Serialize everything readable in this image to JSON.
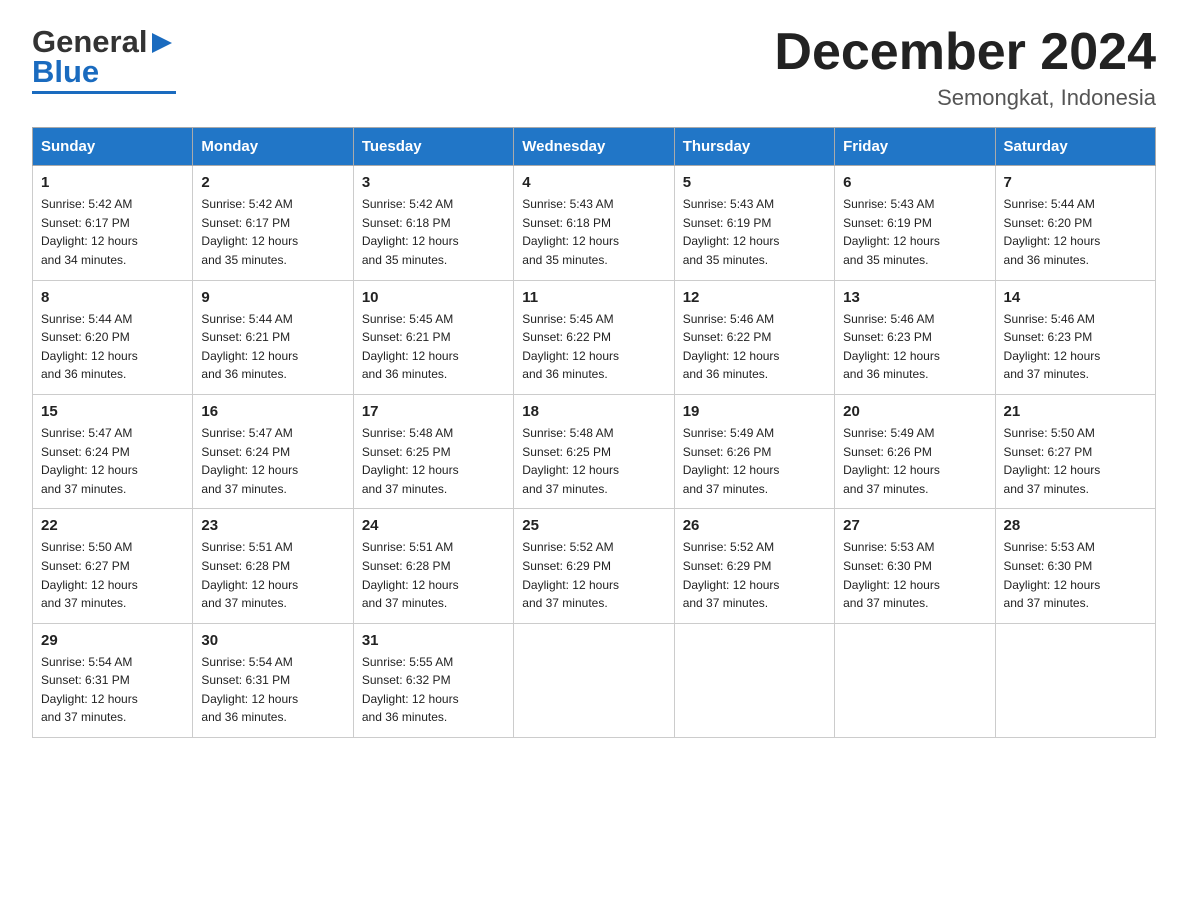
{
  "header": {
    "month_title": "December 2024",
    "location": "Semongkat, Indonesia",
    "logo_general": "General",
    "logo_blue": "Blue"
  },
  "days_of_week": [
    "Sunday",
    "Monday",
    "Tuesday",
    "Wednesday",
    "Thursday",
    "Friday",
    "Saturday"
  ],
  "weeks": [
    [
      {
        "num": "1",
        "sunrise": "5:42 AM",
        "sunset": "6:17 PM",
        "daylight": "12 hours and 34 minutes."
      },
      {
        "num": "2",
        "sunrise": "5:42 AM",
        "sunset": "6:17 PM",
        "daylight": "12 hours and 35 minutes."
      },
      {
        "num": "3",
        "sunrise": "5:42 AM",
        "sunset": "6:18 PM",
        "daylight": "12 hours and 35 minutes."
      },
      {
        "num": "4",
        "sunrise": "5:43 AM",
        "sunset": "6:18 PM",
        "daylight": "12 hours and 35 minutes."
      },
      {
        "num": "5",
        "sunrise": "5:43 AM",
        "sunset": "6:19 PM",
        "daylight": "12 hours and 35 minutes."
      },
      {
        "num": "6",
        "sunrise": "5:43 AM",
        "sunset": "6:19 PM",
        "daylight": "12 hours and 35 minutes."
      },
      {
        "num": "7",
        "sunrise": "5:44 AM",
        "sunset": "6:20 PM",
        "daylight": "12 hours and 36 minutes."
      }
    ],
    [
      {
        "num": "8",
        "sunrise": "5:44 AM",
        "sunset": "6:20 PM",
        "daylight": "12 hours and 36 minutes."
      },
      {
        "num": "9",
        "sunrise": "5:44 AM",
        "sunset": "6:21 PM",
        "daylight": "12 hours and 36 minutes."
      },
      {
        "num": "10",
        "sunrise": "5:45 AM",
        "sunset": "6:21 PM",
        "daylight": "12 hours and 36 minutes."
      },
      {
        "num": "11",
        "sunrise": "5:45 AM",
        "sunset": "6:22 PM",
        "daylight": "12 hours and 36 minutes."
      },
      {
        "num": "12",
        "sunrise": "5:46 AM",
        "sunset": "6:22 PM",
        "daylight": "12 hours and 36 minutes."
      },
      {
        "num": "13",
        "sunrise": "5:46 AM",
        "sunset": "6:23 PM",
        "daylight": "12 hours and 36 minutes."
      },
      {
        "num": "14",
        "sunrise": "5:46 AM",
        "sunset": "6:23 PM",
        "daylight": "12 hours and 37 minutes."
      }
    ],
    [
      {
        "num": "15",
        "sunrise": "5:47 AM",
        "sunset": "6:24 PM",
        "daylight": "12 hours and 37 minutes."
      },
      {
        "num": "16",
        "sunrise": "5:47 AM",
        "sunset": "6:24 PM",
        "daylight": "12 hours and 37 minutes."
      },
      {
        "num": "17",
        "sunrise": "5:48 AM",
        "sunset": "6:25 PM",
        "daylight": "12 hours and 37 minutes."
      },
      {
        "num": "18",
        "sunrise": "5:48 AM",
        "sunset": "6:25 PM",
        "daylight": "12 hours and 37 minutes."
      },
      {
        "num": "19",
        "sunrise": "5:49 AM",
        "sunset": "6:26 PM",
        "daylight": "12 hours and 37 minutes."
      },
      {
        "num": "20",
        "sunrise": "5:49 AM",
        "sunset": "6:26 PM",
        "daylight": "12 hours and 37 minutes."
      },
      {
        "num": "21",
        "sunrise": "5:50 AM",
        "sunset": "6:27 PM",
        "daylight": "12 hours and 37 minutes."
      }
    ],
    [
      {
        "num": "22",
        "sunrise": "5:50 AM",
        "sunset": "6:27 PM",
        "daylight": "12 hours and 37 minutes."
      },
      {
        "num": "23",
        "sunrise": "5:51 AM",
        "sunset": "6:28 PM",
        "daylight": "12 hours and 37 minutes."
      },
      {
        "num": "24",
        "sunrise": "5:51 AM",
        "sunset": "6:28 PM",
        "daylight": "12 hours and 37 minutes."
      },
      {
        "num": "25",
        "sunrise": "5:52 AM",
        "sunset": "6:29 PM",
        "daylight": "12 hours and 37 minutes."
      },
      {
        "num": "26",
        "sunrise": "5:52 AM",
        "sunset": "6:29 PM",
        "daylight": "12 hours and 37 minutes."
      },
      {
        "num": "27",
        "sunrise": "5:53 AM",
        "sunset": "6:30 PM",
        "daylight": "12 hours and 37 minutes."
      },
      {
        "num": "28",
        "sunrise": "5:53 AM",
        "sunset": "6:30 PM",
        "daylight": "12 hours and 37 minutes."
      }
    ],
    [
      {
        "num": "29",
        "sunrise": "5:54 AM",
        "sunset": "6:31 PM",
        "daylight": "12 hours and 37 minutes."
      },
      {
        "num": "30",
        "sunrise": "5:54 AM",
        "sunset": "6:31 PM",
        "daylight": "12 hours and 36 minutes."
      },
      {
        "num": "31",
        "sunrise": "5:55 AM",
        "sunset": "6:32 PM",
        "daylight": "12 hours and 36 minutes."
      },
      null,
      null,
      null,
      null
    ]
  ],
  "labels": {
    "sunrise": "Sunrise:",
    "sunset": "Sunset:",
    "daylight": "Daylight:"
  },
  "colors": {
    "header_bg": "#2176c7",
    "header_text": "#ffffff",
    "border": "#aaaaaa"
  }
}
